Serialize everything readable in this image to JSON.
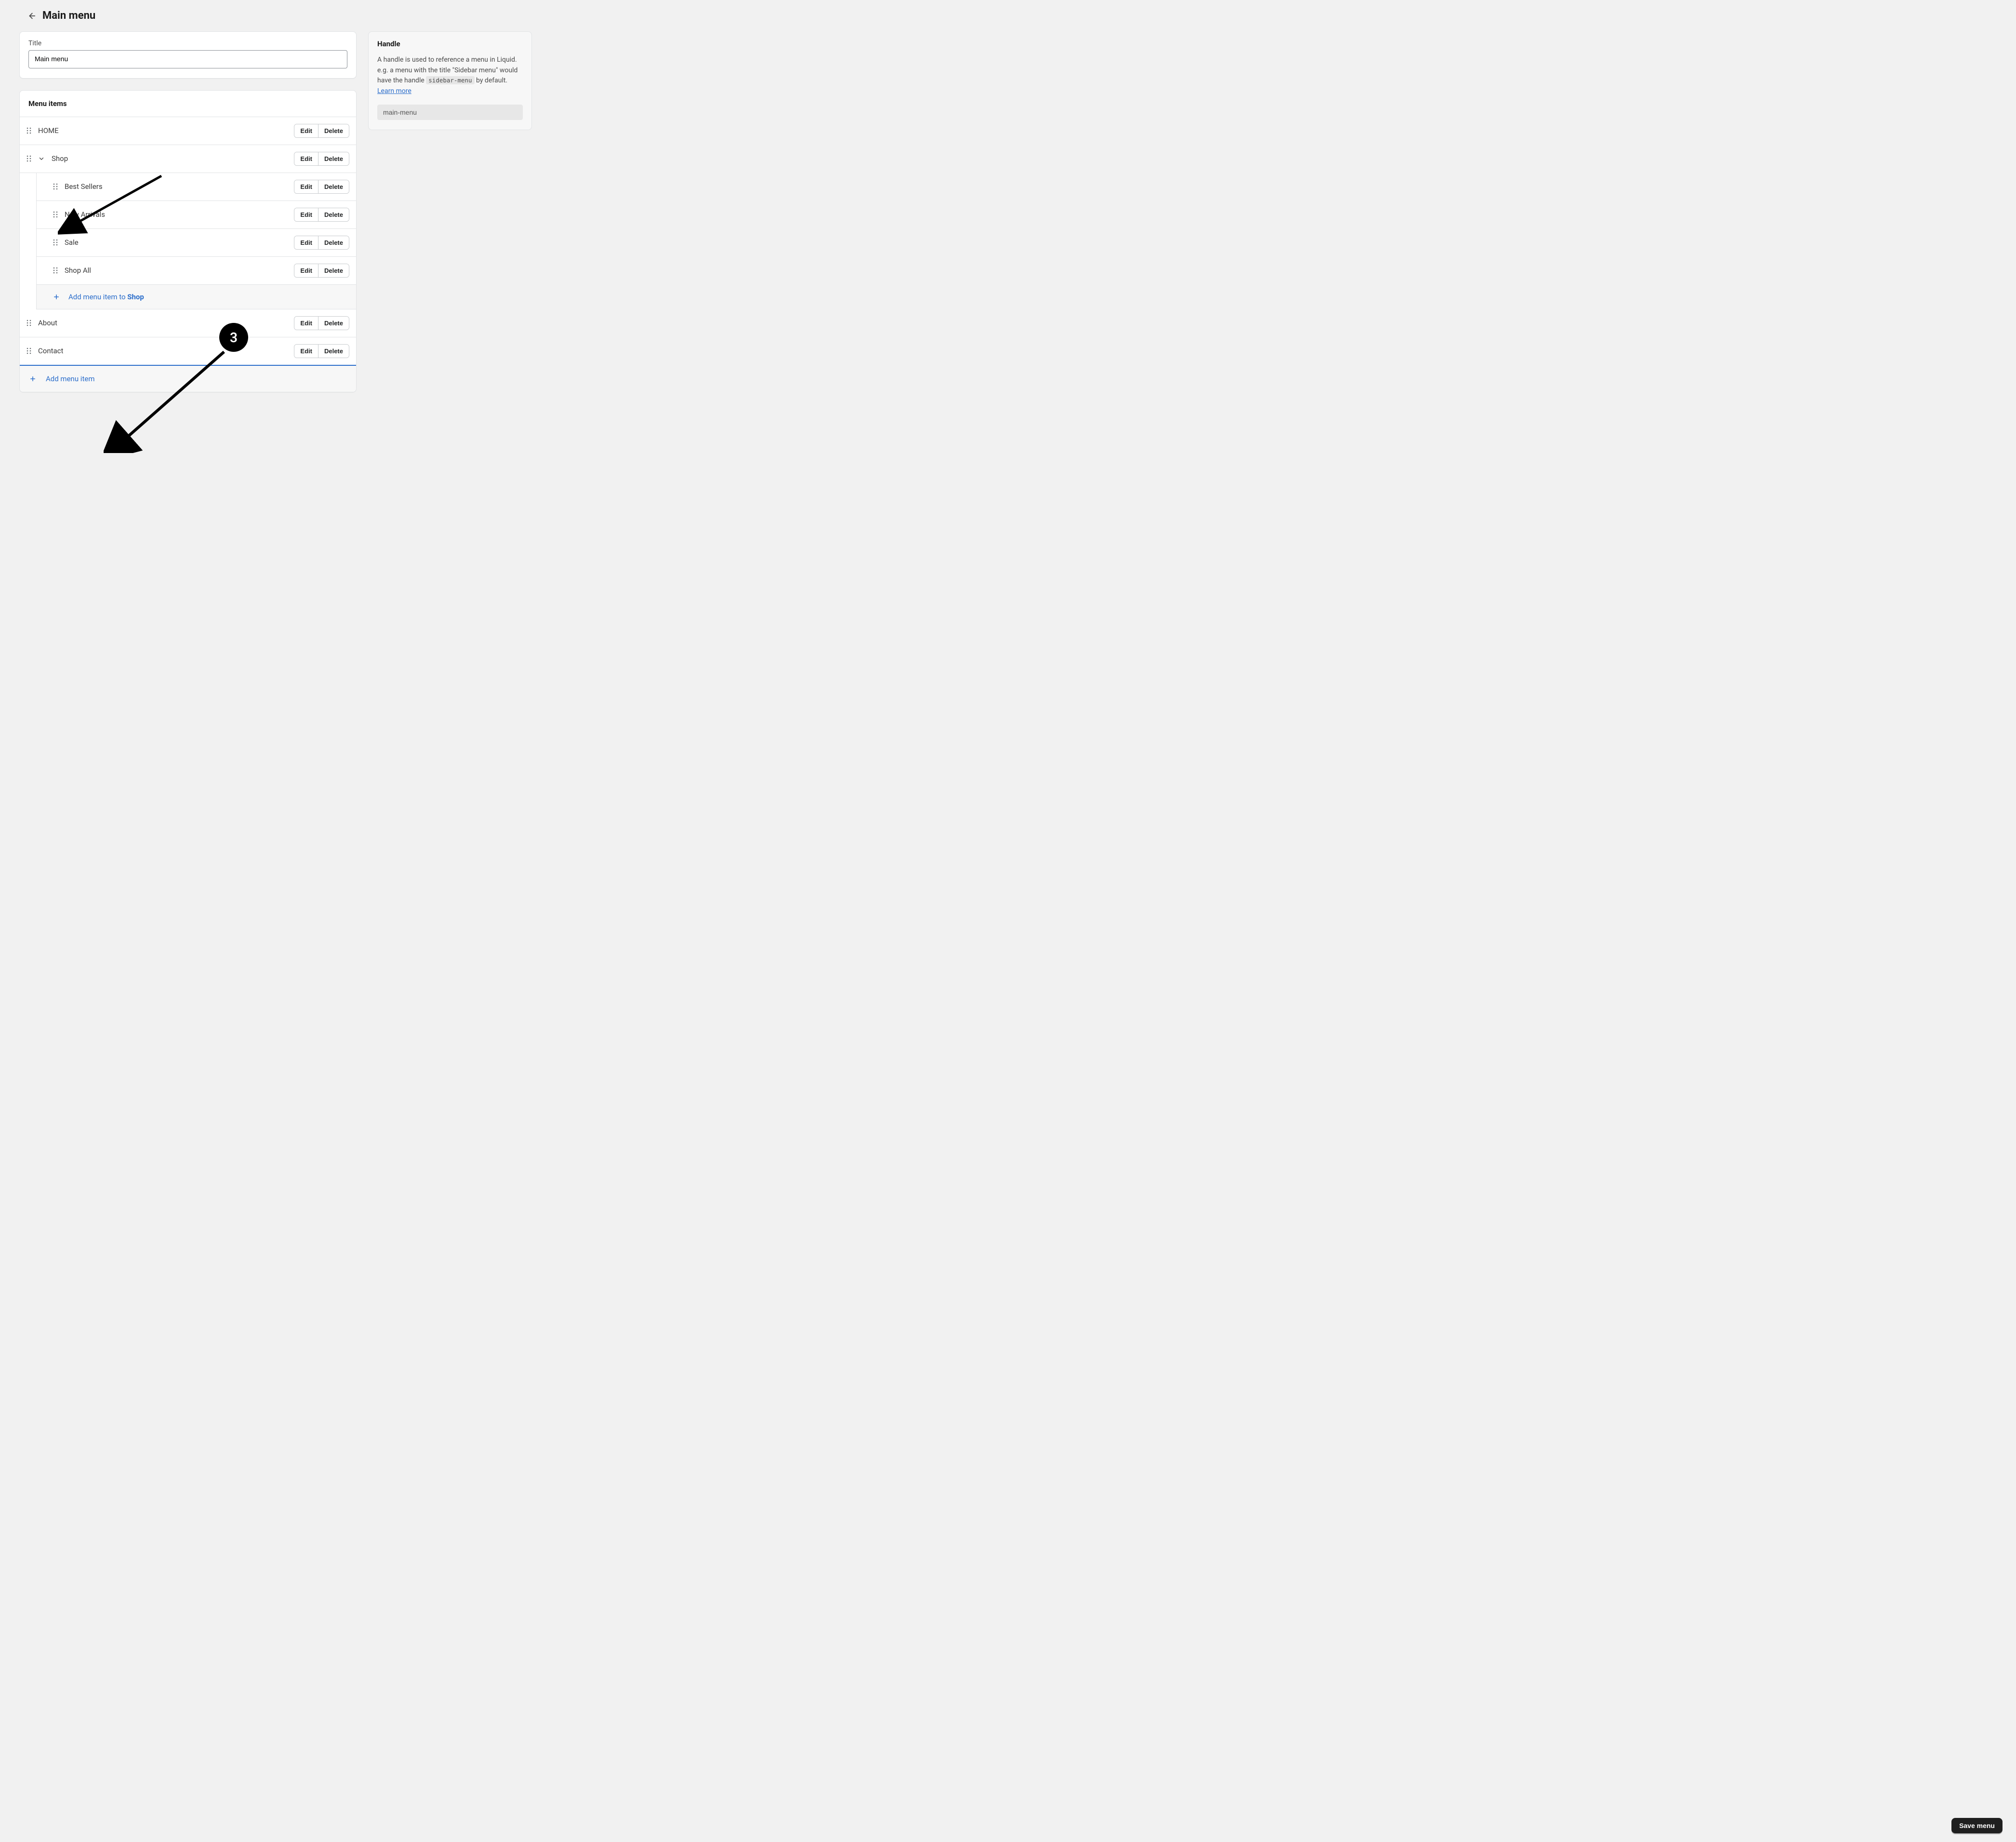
{
  "header": {
    "title": "Main menu"
  },
  "titleCard": {
    "label": "Title",
    "value": "Main menu"
  },
  "menuCard": {
    "heading": "Menu items",
    "editLabel": "Edit",
    "deleteLabel": "Delete",
    "addSubPrefix": "Add menu item to ",
    "addSubTarget": "Shop",
    "addItemLabel": "Add menu item",
    "items": {
      "home": "HOME",
      "shop": "Shop",
      "bestSellers": "Best Sellers",
      "newArrivals": "New Arrivals",
      "sale": "Sale",
      "shopAll": "Shop All",
      "about": "About",
      "contact": "Contact"
    }
  },
  "handleCard": {
    "heading": "Handle",
    "descPrefix": "A handle is used to reference a menu in Liquid. e.g. a menu with the title \"Sidebar menu\" would have the handle ",
    "codeExample": "sidebar-menu",
    "descSuffix": " by default. ",
    "learnMore": "Learn more",
    "value": "main-menu"
  },
  "saveButton": "Save menu",
  "annotation": {
    "badge": "3"
  }
}
